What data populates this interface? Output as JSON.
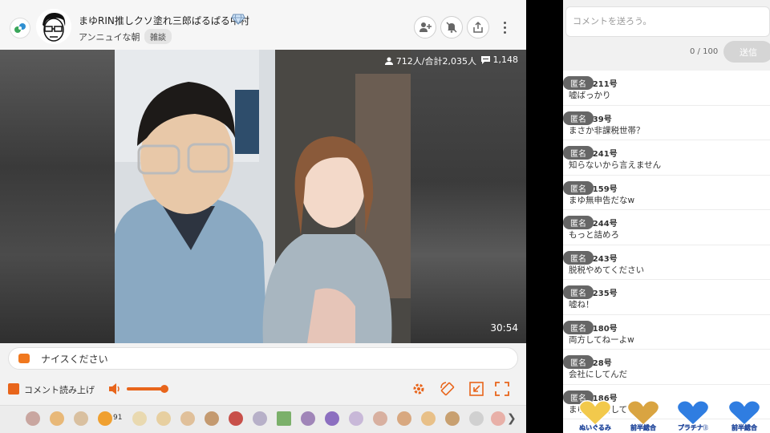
{
  "header": {
    "channel_title": "まゆRIN推しクソ塗れ三郎ぱるぱる中村",
    "sub_title": "アンニュイな朝",
    "genre_tag": "雑談",
    "icons": [
      "logo-icon",
      "avatar",
      "diamond-icon",
      "follow-icon",
      "mute-notification-icon",
      "share-icon",
      "more-icon"
    ]
  },
  "video": {
    "viewers": "712人/合計2,035人",
    "comments": "1,148",
    "elapsed": "30:54"
  },
  "comment_input": {
    "placeholder_text": "ナイスください"
  },
  "controls": {
    "readout_label": "コメント読み上げ",
    "volume_fraction": 0.9,
    "icons": [
      "speaker-icon",
      "settings-icon",
      "rotate-icon",
      "popout-icon",
      "fullscreen-icon"
    ]
  },
  "gifts": {
    "highlight_count": "91"
  },
  "side": {
    "comment_placeholder": "コメントを送ろう。",
    "char_count": "0 / 100",
    "send_label": "送信",
    "comments": [
      {
        "name": "たぬき211号",
        "badge": "匿名",
        "text": "嘘ばっかり"
      },
      {
        "name": "たぬき39号",
        "badge": "匿名",
        "text": "まさか非課税世帯？"
      },
      {
        "name": "たぬき241号",
        "badge": "匿名",
        "text": "知らないから言えません"
      },
      {
        "name": "たぬき159号",
        "badge": "匿名",
        "text": "まゆ無申告だなw"
      },
      {
        "name": "たぬき244号",
        "badge": "匿名",
        "text": "もっと詰めろ"
      },
      {
        "name": "たぬき243号",
        "badge": "匿名",
        "text": "脱税やめてください"
      },
      {
        "name": "たぬき235号",
        "badge": "匿名",
        "text": "嘘ね！"
      },
      {
        "name": "たぬき180号",
        "badge": "匿名",
        "text": "両方してねーよw"
      },
      {
        "name": "たぬき28号",
        "badge": "匿名",
        "text": "会社にしてんだ"
      },
      {
        "name": "たぬき186号",
        "badge": "匿名",
        "text": "まゆは申告してい"
      }
    ],
    "badges": [
      {
        "caption": "ぬいぐるみ",
        "color": "#f2c94c"
      },
      {
        "caption": "前半総合",
        "color": "#d9a441"
      },
      {
        "caption": "プラチナB",
        "color": "#2f7de1"
      },
      {
        "caption": "前半総合",
        "color": "#2f7de1"
      }
    ]
  }
}
